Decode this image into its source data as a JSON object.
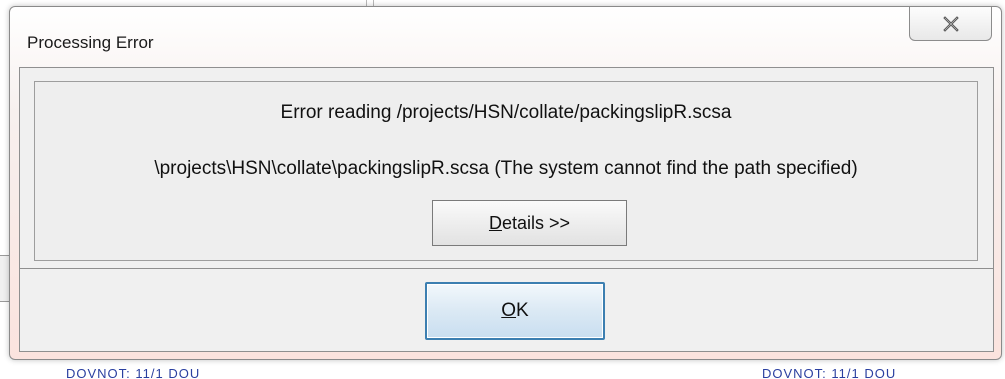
{
  "background": {
    "text_left": "DOVNOT: 11/1 DOU",
    "text_right": "DOVNOT: 11/1 DOU"
  },
  "window": {
    "title": "Processing Error",
    "close_icon": "close-icon"
  },
  "message": {
    "line1": "Error reading /projects/HSN/collate/packingslipR.scsa",
    "line2": "\\projects\\HSN\\collate\\packingslipR.scsa (The system cannot find the path specified)"
  },
  "buttons": {
    "details_mnemonic": "D",
    "details_rest": "etails >>",
    "ok_mnemonic": "O",
    "ok_rest": "K"
  },
  "colors": {
    "ok_border": "#3c7fb1",
    "titlebar_tint": "#fbe3de",
    "client_bg": "#f0f0f0"
  }
}
